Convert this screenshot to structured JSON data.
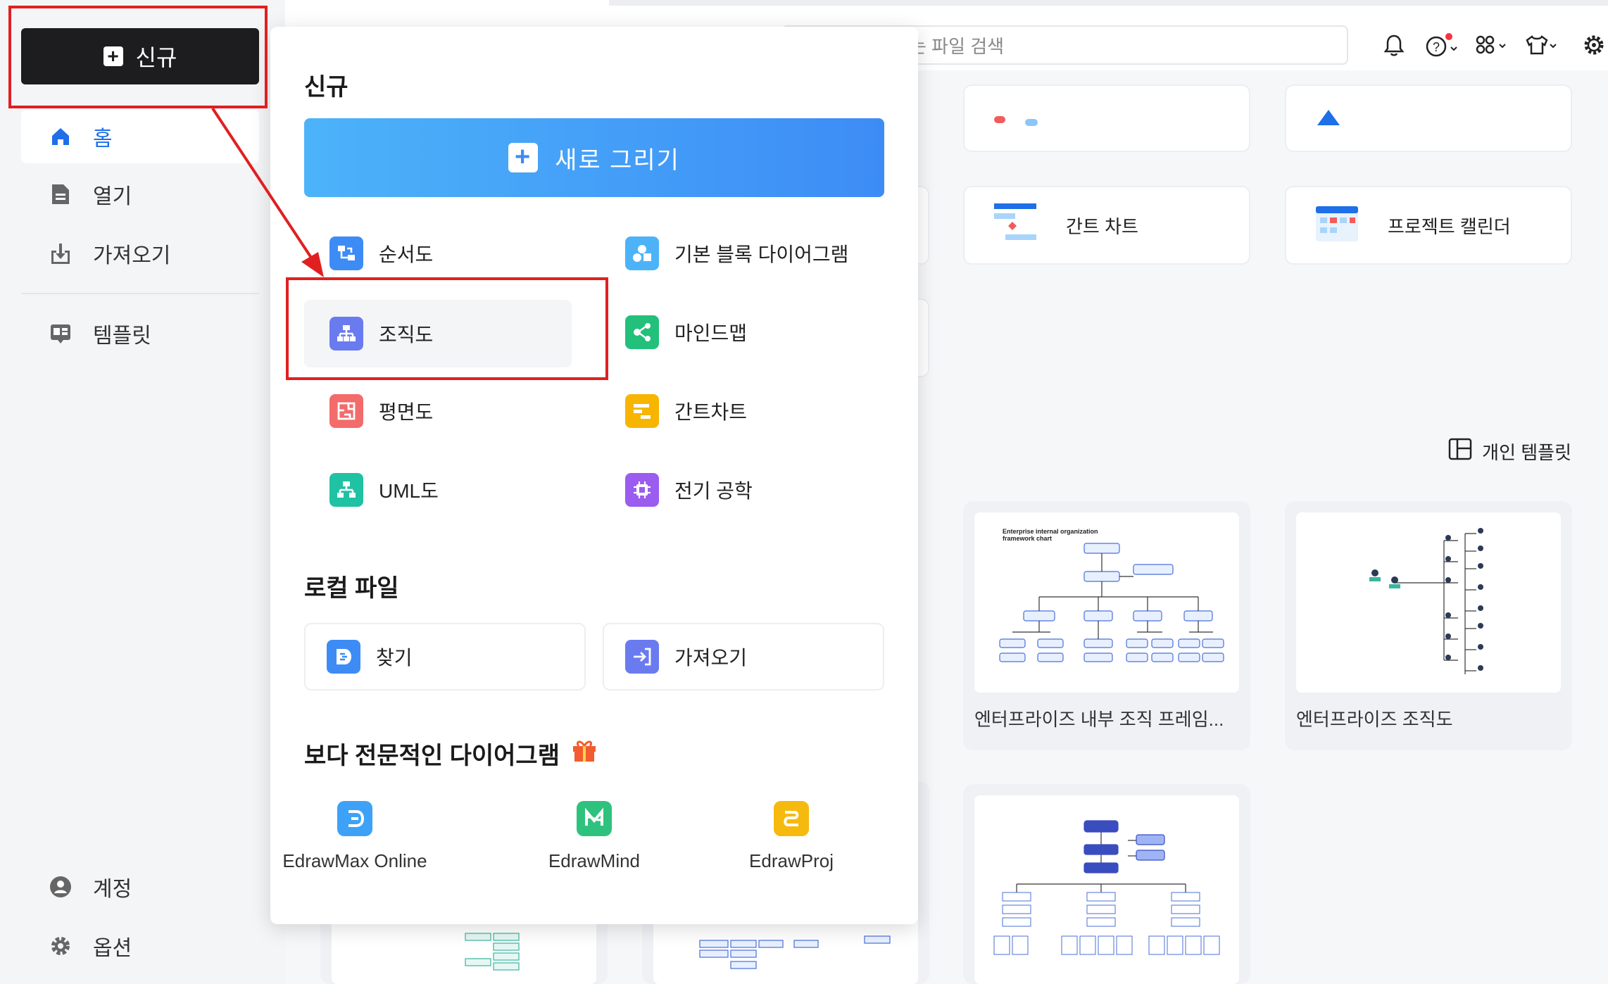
{
  "sidebar": {
    "new_label": "신규",
    "items": [
      {
        "label": "홈",
        "icon": "home-icon"
      },
      {
        "label": "열기",
        "icon": "document-icon"
      },
      {
        "label": "가져오기",
        "icon": "import-icon"
      },
      {
        "label": "템플릿",
        "icon": "template-icon"
      }
    ],
    "bottom": [
      {
        "label": "계정",
        "icon": "account-icon"
      },
      {
        "label": "옵션",
        "icon": "gear-icon"
      }
    ]
  },
  "topbar": {
    "search_placeholder": "는 파일 검색"
  },
  "main": {
    "cards": [
      {
        "label": "간트 차트",
        "icon": "gantt-icon"
      },
      {
        "label": "프로젝트 캘린더",
        "icon": "calendar-icon"
      }
    ],
    "personal_templates": "개인 템플릿",
    "templates": [
      {
        "title": "엔터프라이즈 내부 조직 프레임...",
        "thumb_heading": "Enterprise internal organization framework chart"
      },
      {
        "title": "엔터프라이즈 조직도"
      }
    ]
  },
  "popup": {
    "title": "신규",
    "draw_label": "새로 그리기",
    "options": [
      {
        "label": "순서도",
        "icon": "flowchart-icon",
        "color": "#3d8cf6"
      },
      {
        "label": "기본 블록 다이어그램",
        "icon": "basic-block-icon",
        "color": "#4cb3f9"
      },
      {
        "label": "조직도",
        "icon": "orgchart-icon",
        "color": "#6a7bf0"
      },
      {
        "label": "마인드맵",
        "icon": "mindmap-icon",
        "color": "#22c07a"
      },
      {
        "label": "평면도",
        "icon": "floorplan-icon",
        "color": "#f36b6b"
      },
      {
        "label": "간트차트",
        "icon": "gantt-chart-icon",
        "color": "#f7b500"
      },
      {
        "label": "UML도",
        "icon": "uml-icon",
        "color": "#1fc2a2"
      },
      {
        "label": "전기 공학",
        "icon": "electrical-icon",
        "color": "#9b5cf0"
      }
    ],
    "local_title": "로컬 파일",
    "local": [
      {
        "label": "찾기",
        "icon": "find-icon",
        "color": "#3d8cf6"
      },
      {
        "label": "가져오기",
        "icon": "import-file-icon",
        "color": "#6a7bf0"
      }
    ],
    "pro_title": "보다 전문적인 다이어그램",
    "apps": [
      {
        "label": "EdrawMax Online",
        "icon": "edrawmax-icon",
        "color": "#3da2f7"
      },
      {
        "label": "EdrawMind",
        "icon": "edrawmind-icon",
        "color": "#2fc27e"
      },
      {
        "label": "EdrawProj",
        "icon": "edrawproj-icon",
        "color": "#f6b90d"
      }
    ]
  }
}
